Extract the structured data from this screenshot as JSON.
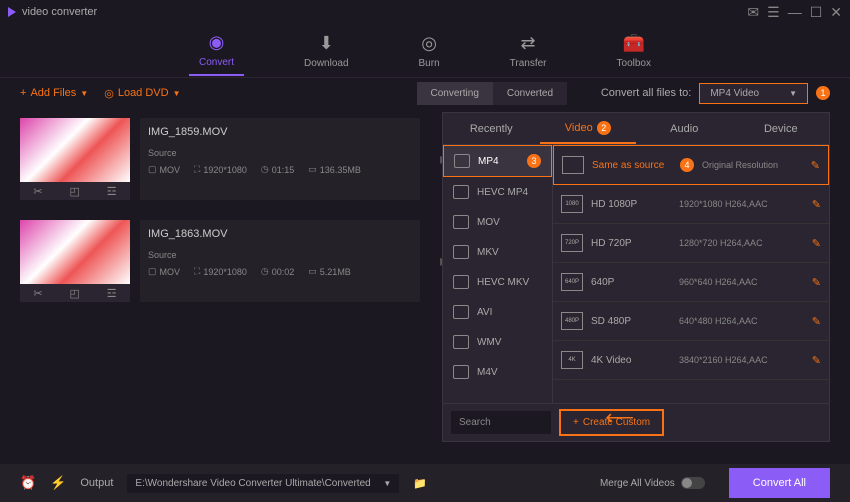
{
  "app": {
    "title": "video converter"
  },
  "window_controls": {
    "msg": "✉",
    "menu": "☰",
    "min": "—",
    "max": "☐",
    "close": "✕"
  },
  "main_tabs": [
    {
      "label": "Convert",
      "icon": "◉"
    },
    {
      "label": "Download",
      "icon": "⬇"
    },
    {
      "label": "Burn",
      "icon": "◎"
    },
    {
      "label": "Transfer",
      "icon": "⇄"
    },
    {
      "label": "Toolbox",
      "icon": "🧰"
    }
  ],
  "toolbar": {
    "add_files": "Add Files",
    "load_dvd": "Load DVD",
    "sub_tabs": [
      "Converting",
      "Converted"
    ],
    "convert_all_label": "Convert all files to:",
    "convert_all_value": "MP4 Video",
    "badge1": "1"
  },
  "files": [
    {
      "name": "IMG_1859.MOV",
      "source_label": "Source",
      "format": "MOV",
      "res": "1920*1080",
      "dur": "01:15",
      "size": "136.35MB"
    },
    {
      "name": "IMG_1863.MOV",
      "source_label": "Source",
      "format": "MOV",
      "res": "1920*1080",
      "dur": "00:02",
      "size": "5.21MB"
    }
  ],
  "format_panel": {
    "tabs": [
      "Recently",
      "Video",
      "Audio",
      "Device"
    ],
    "badge2": "2",
    "formats": [
      "MP4",
      "HEVC MP4",
      "MOV",
      "MKV",
      "HEVC MKV",
      "AVI",
      "WMV",
      "M4V"
    ],
    "badge3": "3",
    "resolutions": [
      {
        "name": "Same as source",
        "detail": "Original Resolution",
        "hl": true
      },
      {
        "name": "HD 1080P",
        "detail": "1920*1080\nH264,AAC"
      },
      {
        "name": "HD 720P",
        "detail": "1280*720\nH264,AAC"
      },
      {
        "name": "640P",
        "detail": "960*640\nH264,AAC"
      },
      {
        "name": "SD 480P",
        "detail": "640*480\nH264,AAC"
      },
      {
        "name": "4K Video",
        "detail": "3840*2160\nH264,AAC"
      }
    ],
    "badge4": "4",
    "search_placeholder": "Search",
    "create_custom": "Create Custom"
  },
  "footer": {
    "output_label": "Output",
    "output_path": "E:\\Wondershare Video Converter Ultimate\\Converted",
    "merge_label": "Merge All Videos",
    "convert_btn": "Convert All"
  }
}
